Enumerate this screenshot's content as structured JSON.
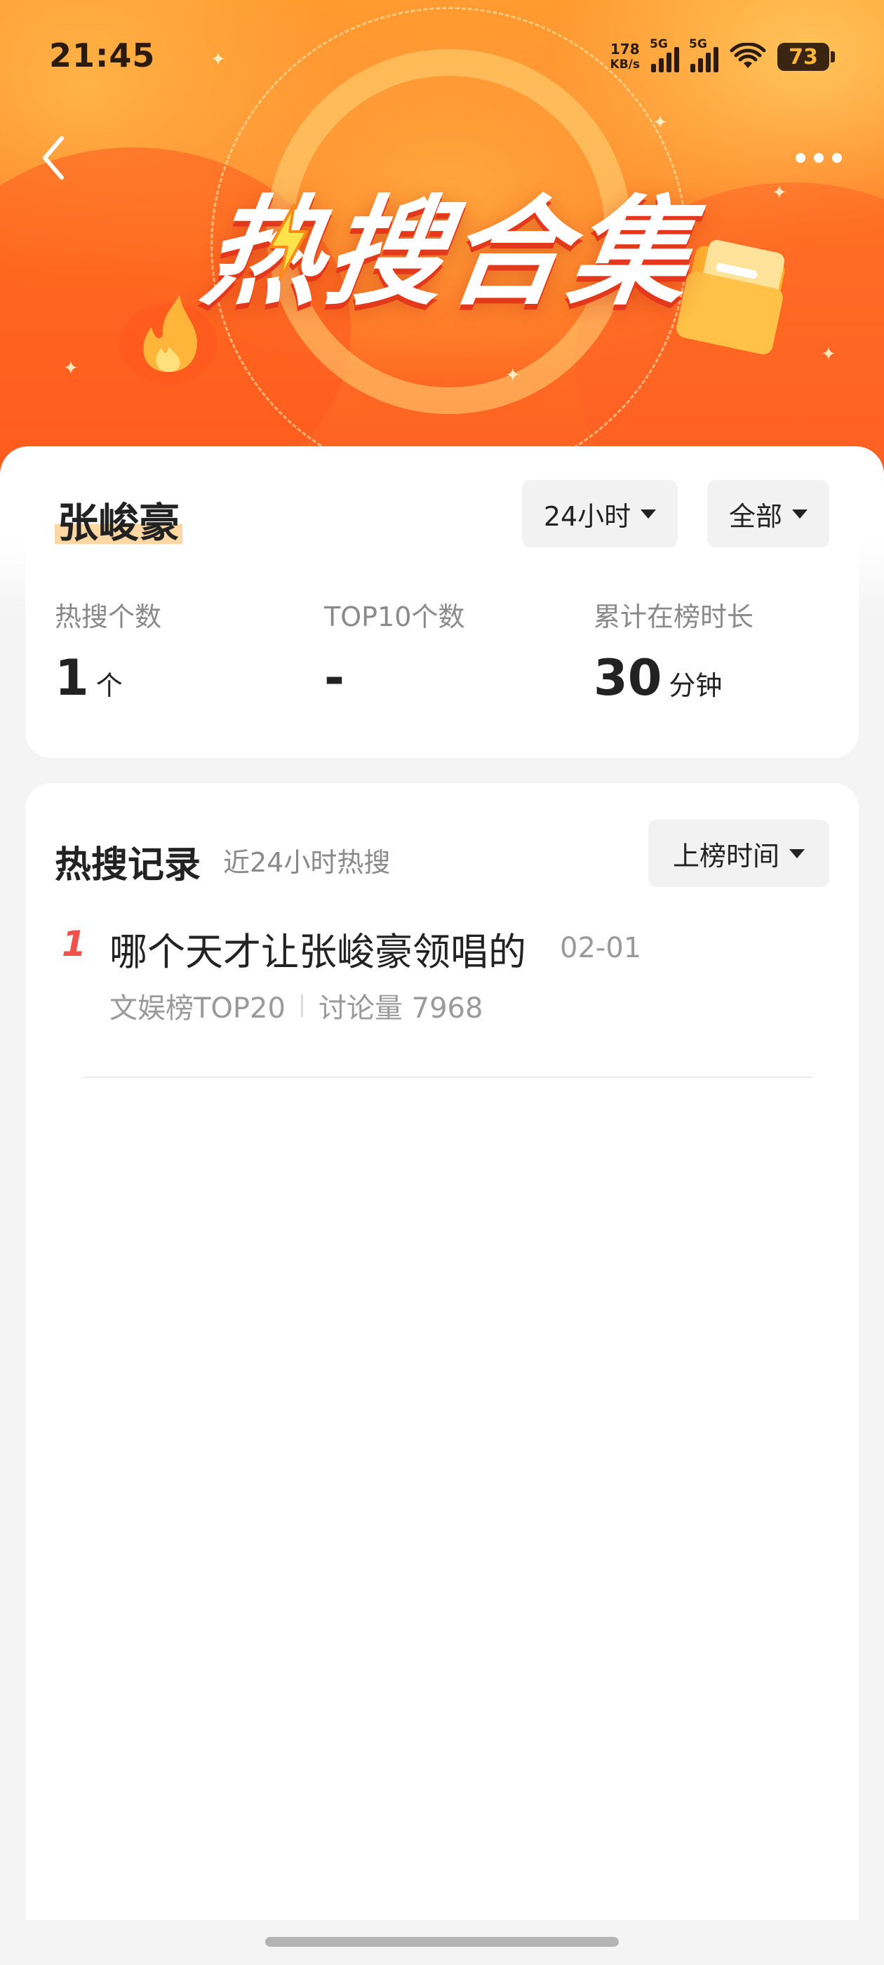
{
  "status_bar": {
    "time": "21:45",
    "net_speed_value": "178",
    "net_speed_unit": "KB/s",
    "sim1_label": "5G",
    "sim2_label": "5G",
    "battery_level": "73"
  },
  "header": {
    "banner_title": "热搜合集",
    "back_icon": "chevron-left-icon",
    "more_icon": "more-dots-icon"
  },
  "summary": {
    "name": "张峻豪",
    "range_filter": "24小时",
    "type_filter": "全部",
    "stats": [
      {
        "label": "热搜个数",
        "value": "1",
        "unit": "个"
      },
      {
        "label": "TOP10个数",
        "value": "-",
        "unit": ""
      },
      {
        "label": "累计在榜时长",
        "value": "30",
        "unit": "分钟"
      }
    ]
  },
  "records": {
    "title": "热搜记录",
    "subtitle": "近24小时热搜",
    "sort_label": "上榜时间",
    "items": [
      {
        "rank": "1",
        "title": "哪个天才让张峻豪领唱的",
        "date": "02-01",
        "board": "文娱榜TOP20",
        "discussion": "讨论量 7968"
      }
    ]
  },
  "colors": {
    "accent_orange": "#ff7a24",
    "rank_red": "#f0524a",
    "name_highlight": "#ffd7a3"
  }
}
